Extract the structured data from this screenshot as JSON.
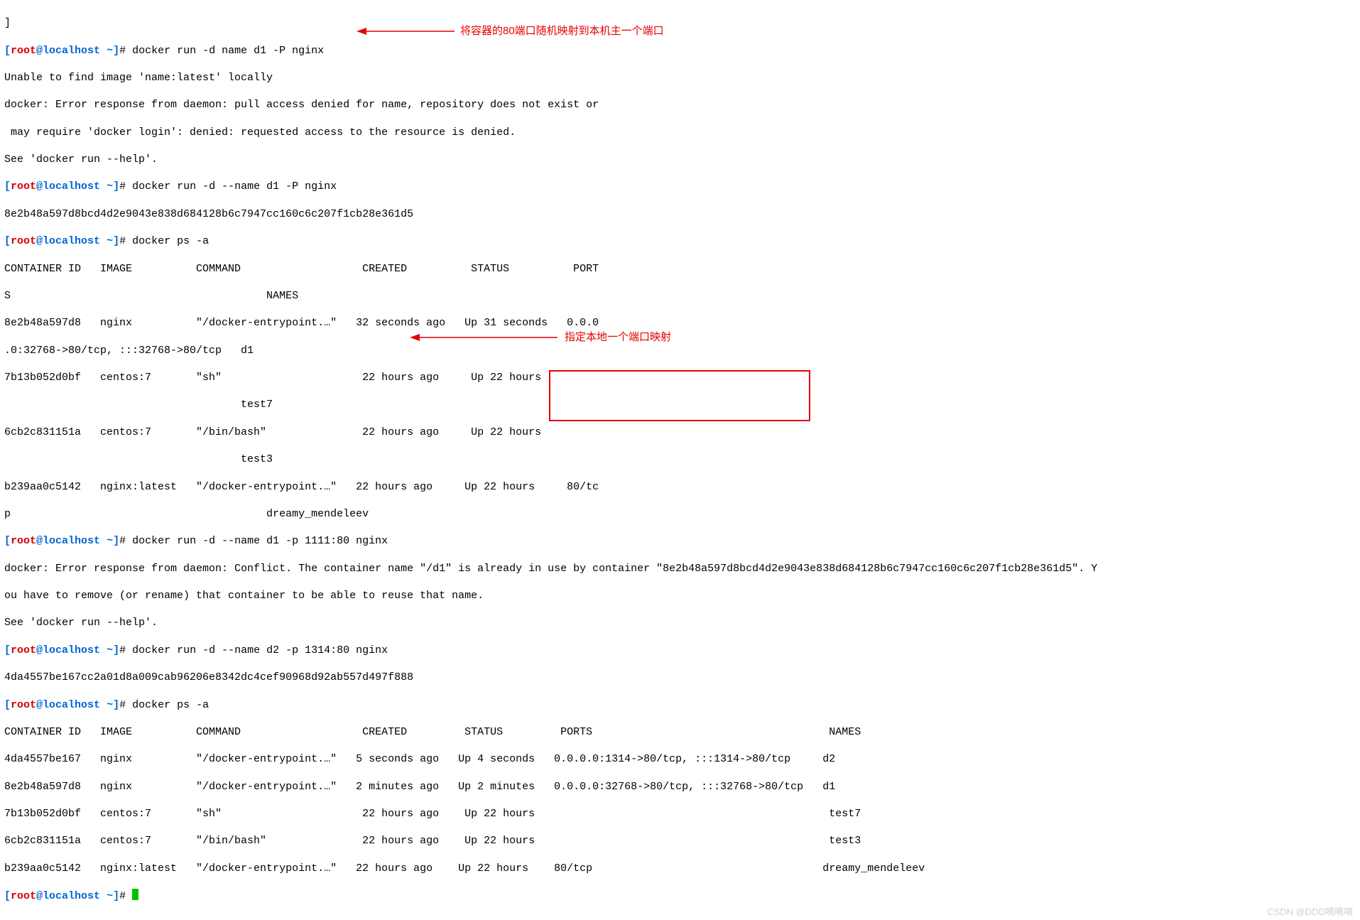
{
  "annotations": {
    "a1": "将容器的80端口随机映射到本机主一个端口",
    "a2": "指定本地一个端口映射"
  },
  "watermark": "CSDN @DDD嘀嘀嘀",
  "lines": {
    "l0": "]",
    "cmd1": "docker run -d name d1 -P nginx",
    "l1a": "Unable to find image 'name:latest' locally",
    "l1b": "docker: Error response from daemon: pull access denied for name, repository does not exist or",
    "l1c": " may require 'docker login': denied: requested access to the resource is denied.",
    "l1d": "See 'docker run --help'.",
    "cmd2": "docker run -d --name d1 -P nginx",
    "l2a": "8e2b48a597d8bcd4d2e9043e838d684128b6c7947cc160c6c207f1cb28e361d5",
    "cmd3": "docker ps -a",
    "hdr1a": "CONTAINER ID   IMAGE          COMMAND                   CREATED          STATUS          PORT",
    "hdr1b": "S                                        NAMES",
    "r1a": "8e2b48a597d8   nginx          \"/docker-entrypoint.…\"   32 seconds ago   Up 31 seconds   0.0.0",
    "r1b": ".0:32768->80/tcp, :::32768->80/tcp   d1",
    "r2a": "7b13b052d0bf   centos:7       \"sh\"                      22 hours ago     Up 22 hours",
    "r2b": "                                     test7",
    "r3a": "6cb2c831151a   centos:7       \"/bin/bash\"               22 hours ago     Up 22 hours",
    "r3b": "                                     test3",
    "r4a": "b239aa0c5142   nginx:latest   \"/docker-entrypoint.…\"   22 hours ago     Up 22 hours     80/tc",
    "r4b": "p                                        dreamy_mendeleev",
    "cmd4": "docker run -d --name d1 -p 1111:80 nginx",
    "l4a": "docker: Error response from daemon: Conflict. The container name \"/d1\" is already in use by container \"8e2b48a597d8bcd4d2e9043e838d684128b6c7947cc160c6c207f1cb28e361d5\". Y",
    "l4b": "ou have to remove (or rename) that container to be able to reuse that name.",
    "l4c": "See 'docker run --help'.",
    "cmd5": "docker run -d --name d2 -p 1314:80 nginx",
    "l5a": "4da4557be167cc2a01d8a009cab96206e8342dc4cef90968d92ab557d497f888",
    "cmd6": "docker ps -a",
    "hdr2": "CONTAINER ID   IMAGE          COMMAND                   CREATED         STATUS         PORTS                                     NAMES",
    "t1": "4da4557be167   nginx          \"/docker-entrypoint.…\"   5 seconds ago   Up 4 seconds   0.0.0.0:1314->80/tcp, :::1314->80/tcp     d2",
    "t2": "8e2b48a597d8   nginx          \"/docker-entrypoint.…\"   2 minutes ago   Up 2 minutes   0.0.0.0:32768->80/tcp, :::32768->80/tcp   d1",
    "t3": "7b13b052d0bf   centos:7       \"sh\"                      22 hours ago    Up 22 hours                                              test7",
    "t4": "6cb2c831151a   centos:7       \"/bin/bash\"               22 hours ago    Up 22 hours                                              test3",
    "t5": "b239aa0c5142   nginx:latest   \"/docker-entrypoint.…\"   22 hours ago    Up 22 hours    80/tcp                                    dreamy_mendeleev"
  },
  "prompt": {
    "user": "root",
    "host": "localhost",
    "path": "~"
  }
}
